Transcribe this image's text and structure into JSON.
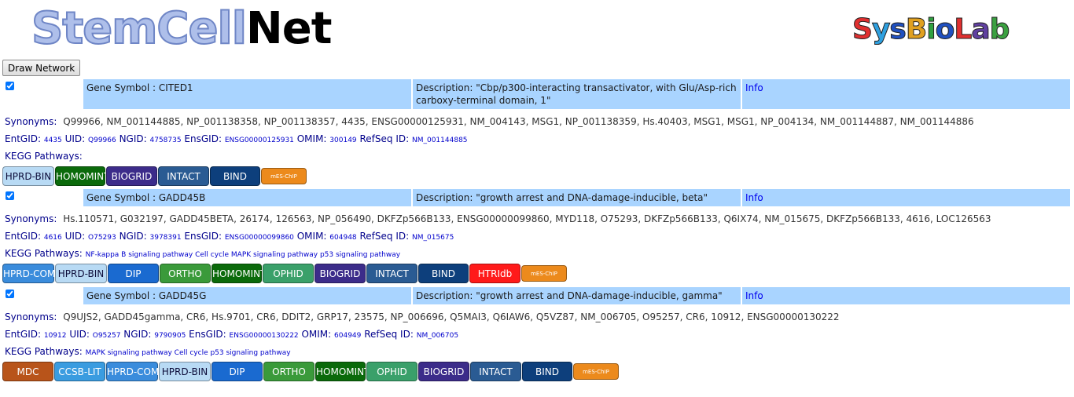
{
  "header": {
    "logo_stem_part1": "StemCell",
    "logo_stem_part2": "Net",
    "logo_sys": [
      "S",
      "y",
      "s",
      "B",
      "i",
      "o",
      "L",
      "a",
      "b"
    ],
    "logo_sys_colors": [
      "#e03030",
      "#2ea0e0",
      "#2050c0",
      "#e0a020",
      "#30a040",
      "#2050c0",
      "#e03030",
      "#6040a0",
      "#3aa040"
    ]
  },
  "toolbar": {
    "draw_network_label": "Draw Network"
  },
  "labels": {
    "gene_symbol_prefix": "Gene Symbol : ",
    "description_prefix": "Description: ",
    "info": "Info",
    "synonyms": "Synonyms:",
    "entgid": "EntGID:",
    "uid": "UID:",
    "ngid": "NGID:",
    "ensgid": "EnsGID:",
    "omim": "OMIM:",
    "refseq": "RefSeq ID:",
    "kegg": "KEGG Pathways:"
  },
  "colors": {
    "HPRD-BIN": "#b8daf4",
    "HOMOMINT": "#0b6a0b",
    "BIOGRID": "#3c2c8a",
    "INTACT": "#2a5b93",
    "BIND": "#0d3f7c",
    "mES-ChIP": "#ec8a1c",
    "HPRD-COMP": "#3a8cdc",
    "DIP": "#1a6ad0",
    "ORTHO": "#3a9a3a",
    "OPHID": "#3aa06a",
    "HTRIdb": "#ff1a1a",
    "MDC": "#b8541a",
    "CCSB-LIT": "#3a9ce0"
  },
  "genes": [
    {
      "checked": true,
      "symbol": "CITED1",
      "description": "\"Cbp/p300-interacting transactivator, with Glu/Asp-rich carboxy-terminal domain, 1\"",
      "synonyms": "Q99966, NM_001144885, NP_001138358, NP_001138357, 4435, ENSG00000125931, NM_004143, MSG1, NP_001138359, Hs.40403, MSG1, MSG1, NP_004134, NM_001144887, NM_001144886",
      "entgid": "4435",
      "uid": "Q99966",
      "ngid": "4758735",
      "ensgid": "ENSG00000125931",
      "omim": "300149",
      "refseq": "NM_001144885",
      "kegg": "",
      "databases": [
        "HPRD-BIN",
        "HOMOMINT",
        "BIOGRID",
        "INTACT",
        "BIND",
        "mES-ChIP"
      ]
    },
    {
      "checked": true,
      "symbol": "GADD45B",
      "description": "\"growth arrest and DNA-damage-inducible, beta\"",
      "synonyms": "Hs.110571, G032197, GADD45BETA, 26174, 126563, NP_056490, DKFZp566B133, ENSG00000099860, MYD118, O75293, DKFZp566B133, Q6IX74, NM_015675, DKFZp566B133, 4616, LOC126563",
      "entgid": "4616",
      "uid": "O75293",
      "ngid": "3978391",
      "ensgid": "ENSG00000099860",
      "omim": "604948",
      "refseq": "NM_015675",
      "kegg": "NF-kappa B signaling pathway Cell cycle MAPK signaling pathway p53 signaling pathway",
      "databases": [
        "HPRD-COMP",
        "HPRD-BIN",
        "DIP",
        "ORTHO",
        "HOMOMINT",
        "OPHID",
        "BIOGRID",
        "INTACT",
        "BIND",
        "HTRIdb",
        "mES-ChIP"
      ]
    },
    {
      "checked": true,
      "symbol": "GADD45G",
      "description": "\"growth arrest and DNA-damage-inducible, gamma\"",
      "synonyms": "Q9UJS2, GADD45gamma, CR6, Hs.9701, CR6, DDIT2, GRP17, 23575, NP_006696, Q5MAI3, Q6IAW6, Q5VZ87, NM_006705, O95257, CR6, 10912, ENSG00000130222",
      "entgid": "10912",
      "uid": "O95257",
      "ngid": "9790905",
      "ensgid": "ENSG00000130222",
      "omim": "604949",
      "refseq": "NM_006705",
      "kegg": "MAPK signaling pathway Cell cycle p53 signaling pathway",
      "databases": [
        "MDC",
        "CCSB-LIT",
        "HPRD-COMP",
        "HPRD-BIN",
        "DIP",
        "ORTHO",
        "HOMOMINT",
        "OPHID",
        "BIOGRID",
        "INTACT",
        "BIND",
        "mES-ChIP"
      ]
    }
  ]
}
